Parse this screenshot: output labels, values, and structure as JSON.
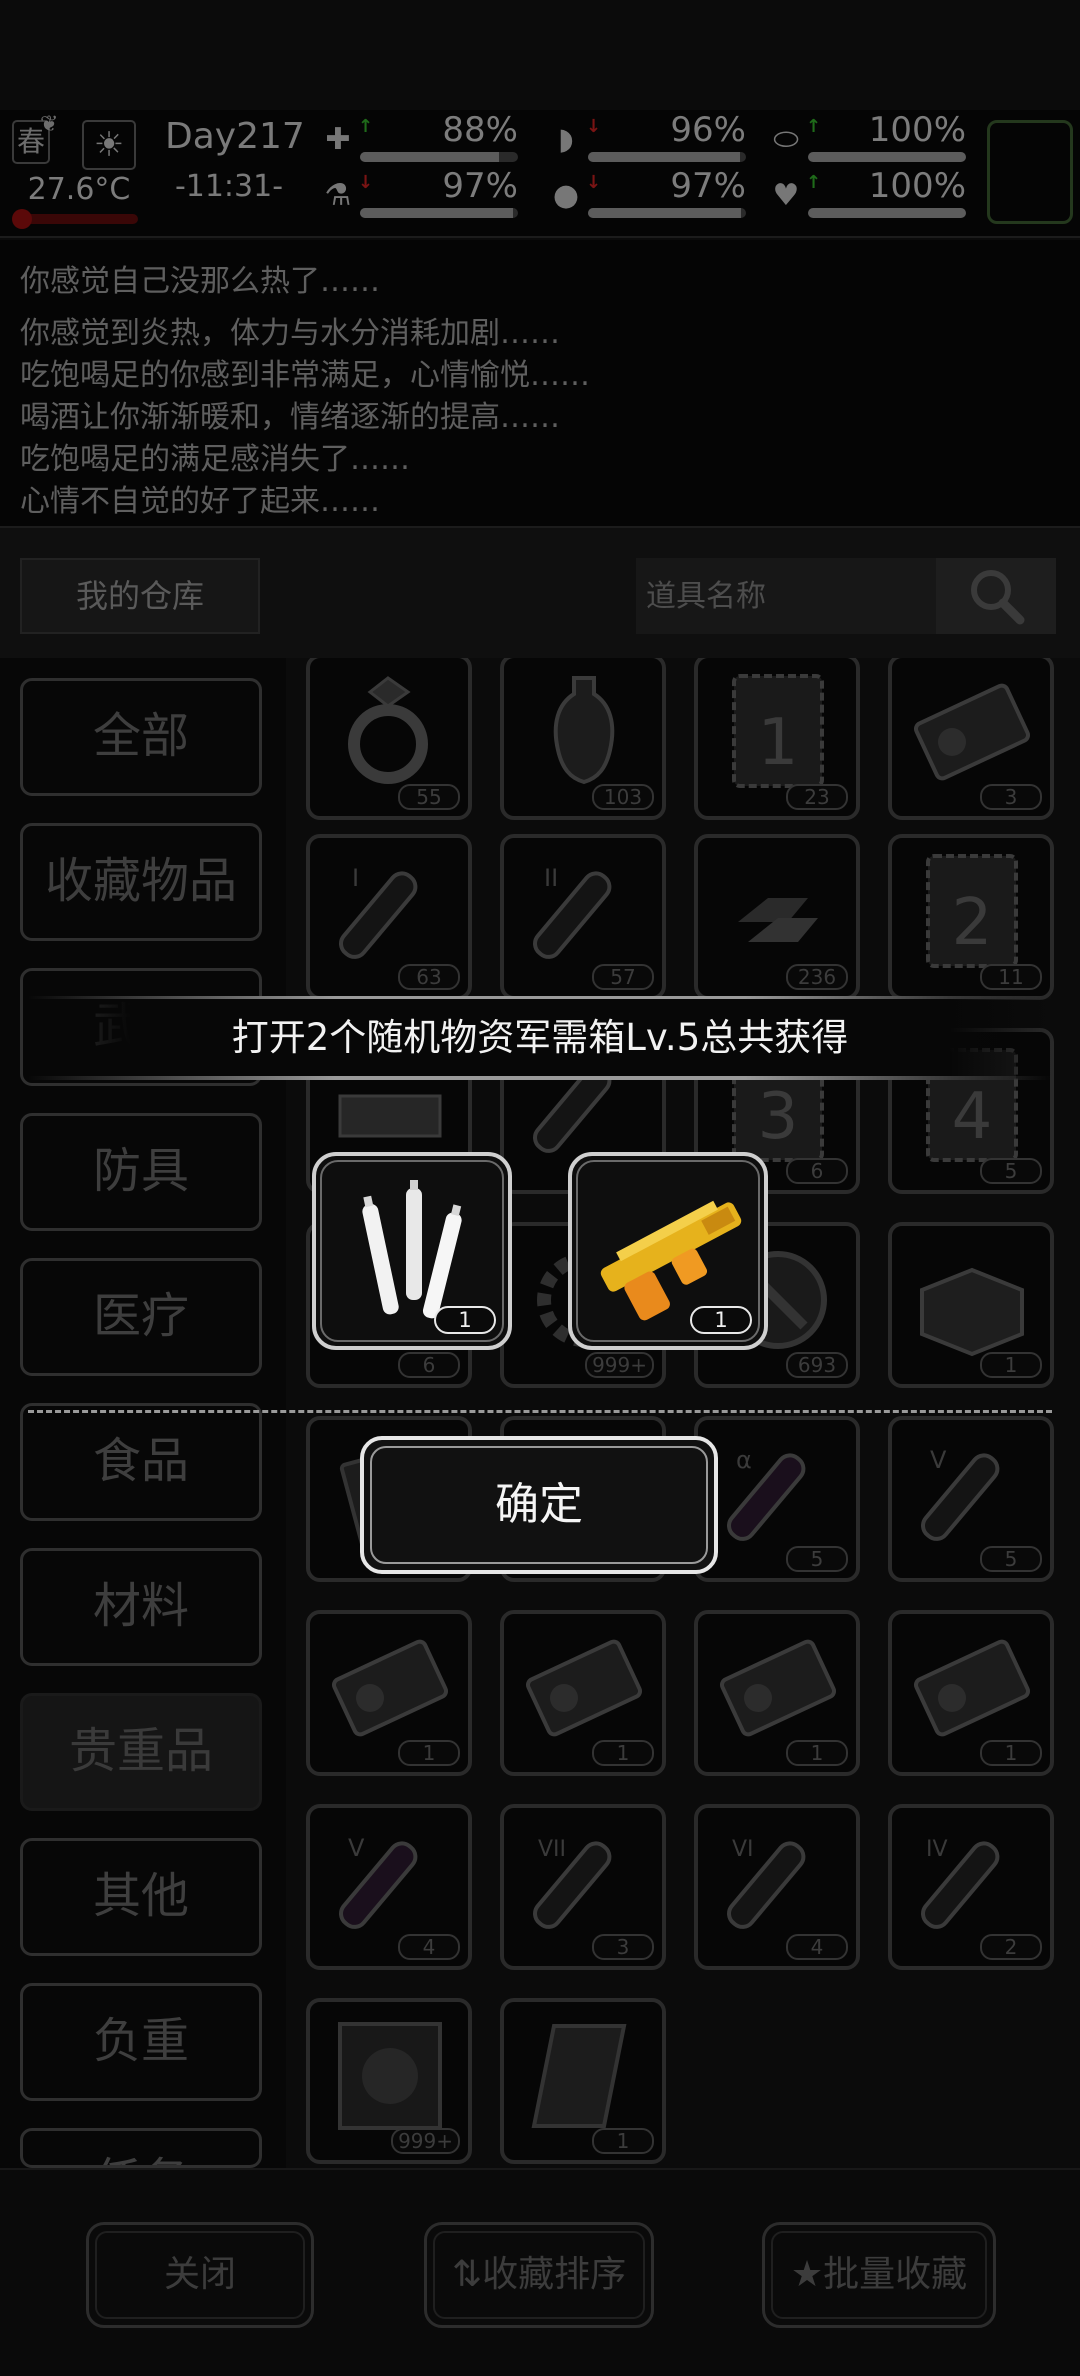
{
  "status": {
    "season": "春",
    "season_icon": "leaf-icon",
    "weather_icon": "sun-icon",
    "temperature": "27.6°C",
    "day": "Day217",
    "time": "-11:31-",
    "stats": [
      {
        "icon": "medkit-icon",
        "glyph": "✚",
        "arrow": "↑",
        "arrow_color": "#1f6b1a",
        "value": "88%",
        "level": 0.88
      },
      {
        "icon": "stomach-icon",
        "glyph": "◗",
        "arrow": "↓",
        "arrow_color": "#7a1414",
        "value": "96%",
        "level": 0.96
      },
      {
        "icon": "pill-icon",
        "glyph": "⬭",
        "arrow": "↑",
        "arrow_color": "#1f6b1a",
        "value": "100%",
        "level": 1.0
      },
      {
        "icon": "flask-icon",
        "glyph": "⚗",
        "arrow": "↓",
        "arrow_color": "#7a1414",
        "value": "97%",
        "level": 0.97
      },
      {
        "icon": "water-drop-icon",
        "glyph": "💧",
        "arrow": "↓",
        "arrow_color": "#7a1414",
        "value": "97%",
        "level": 0.97
      },
      {
        "icon": "heart-icon",
        "glyph": "♥",
        "arrow": "↑",
        "arrow_color": "#1f6b1a",
        "value": "100%",
        "level": 1.0
      }
    ]
  },
  "log": [
    "你感觉自己没那么热了……",
    "你感觉到炎热，体力与水分消耗加剧……",
    "吃饱喝足的你感到非常满足，心情愉悦……",
    "喝酒让你渐渐暖和，情绪逐渐的提高……",
    "吃饱喝足的满足感消失了……",
    "心情不自觉的好了起来……"
  ],
  "warehouse": {
    "title": "我的仓库",
    "search_placeholder": "道具名称",
    "categories": [
      "全部",
      "收藏物品",
      "武器",
      "防具",
      "医疗",
      "食品",
      "材料",
      "贵重品",
      "其他",
      "负重",
      "任务"
    ],
    "active_category": "贵重品"
  },
  "items": [
    {
      "icon": "diamond-ring-icon",
      "count": "55"
    },
    {
      "icon": "vase-icon",
      "count": "103"
    },
    {
      "icon": "level-1-card-icon",
      "count": "23"
    },
    {
      "icon": "ticket-icon",
      "count": "3"
    },
    {
      "icon": "potion-i-icon",
      "count": "63"
    },
    {
      "icon": "potion-ii-icon",
      "count": "57"
    },
    {
      "icon": "gold-bars-icon",
      "count": "236"
    },
    {
      "icon": "level-2-card-icon",
      "count": "11"
    },
    {
      "icon": "cash-stack-icon",
      "count": ""
    },
    {
      "icon": "potion-icon",
      "count": ""
    },
    {
      "icon": "level-3-card-icon",
      "count": "6"
    },
    {
      "icon": "level-4-card-icon",
      "count": "5"
    },
    {
      "icon": "box-icon",
      "count": "6"
    },
    {
      "icon": "gear-icon",
      "count": "999+"
    },
    {
      "icon": "tool-disc-icon",
      "count": "693"
    },
    {
      "icon": "crate-icon",
      "count": "1"
    },
    {
      "icon": "book-icon",
      "count": ""
    },
    {
      "icon": "blank-icon",
      "count": ""
    },
    {
      "icon": "potion-alpha-icon",
      "count": "5"
    },
    {
      "icon": "potion-v-icon",
      "count": "5"
    },
    {
      "icon": "ticket-icon",
      "count": "1"
    },
    {
      "icon": "ticket-icon",
      "count": "1"
    },
    {
      "icon": "ticket-icon",
      "count": "1"
    },
    {
      "icon": "ticket-icon",
      "count": "1"
    },
    {
      "icon": "potion-v-icon",
      "count": "4"
    },
    {
      "icon": "potion-vii-icon",
      "count": "3"
    },
    {
      "icon": "potion-vi-icon",
      "count": "4"
    },
    {
      "icon": "potion-iv-icon",
      "count": "2"
    },
    {
      "icon": "film-poster-icon",
      "count": "999+"
    },
    {
      "icon": "scroll-icon",
      "count": "1"
    }
  ],
  "bottom": {
    "close": "关闭",
    "sort": "收藏排序",
    "batch": "批量收藏"
  },
  "dialog": {
    "title": "打开2个随机物资军需箱Lv.5总共获得",
    "rewards": [
      {
        "icon": "batteries-icon",
        "count": "1"
      },
      {
        "icon": "golden-shotgun-icon",
        "count": "1"
      }
    ],
    "confirm": "确定"
  }
}
